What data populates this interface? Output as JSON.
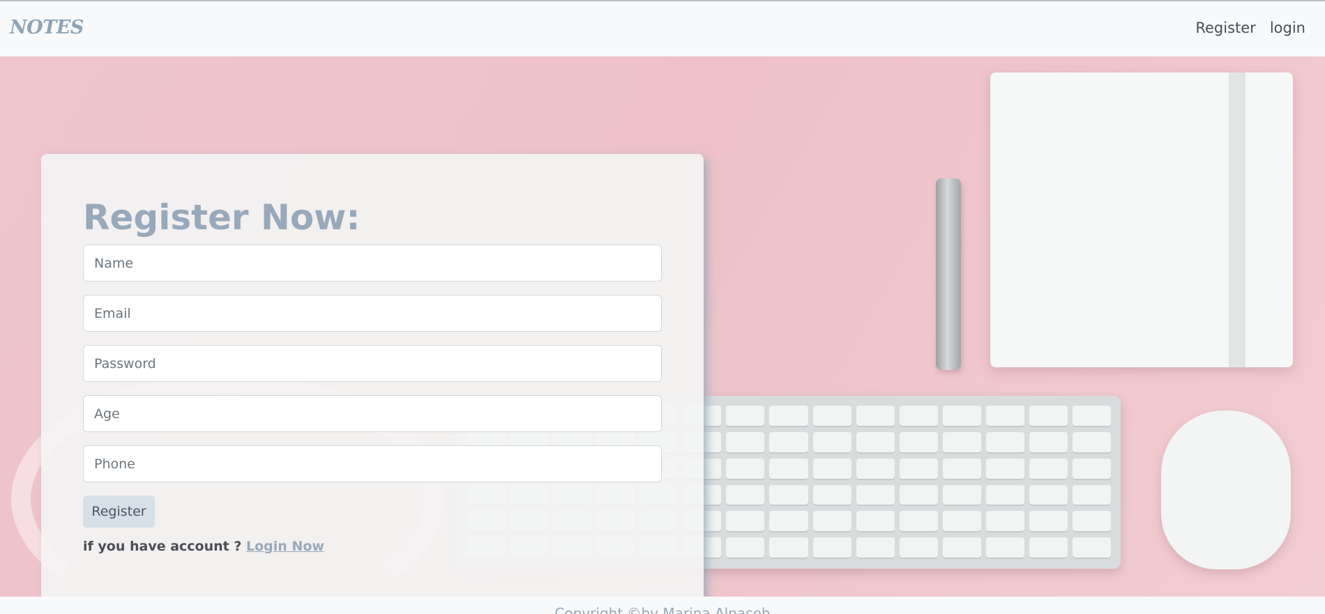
{
  "navbar": {
    "brand": "NOTES",
    "links": [
      {
        "label": "Register"
      },
      {
        "label": "login"
      }
    ]
  },
  "form": {
    "title": "Register Now:",
    "fields": [
      {
        "placeholder": "Name",
        "value": ""
      },
      {
        "placeholder": "Email",
        "value": ""
      },
      {
        "placeholder": "Password",
        "value": ""
      },
      {
        "placeholder": "Age",
        "value": ""
      },
      {
        "placeholder": "Phone",
        "value": ""
      }
    ],
    "submit_label": "Register",
    "account_prompt": "if you have account ?",
    "login_link": "Login Now"
  },
  "footer": {
    "text": "Copyright ©by Marina Alnaseh"
  },
  "colors": {
    "accent": "#97a9ba",
    "hero_background": "#eec1c8",
    "navbar_background": "#f8f9fa"
  }
}
